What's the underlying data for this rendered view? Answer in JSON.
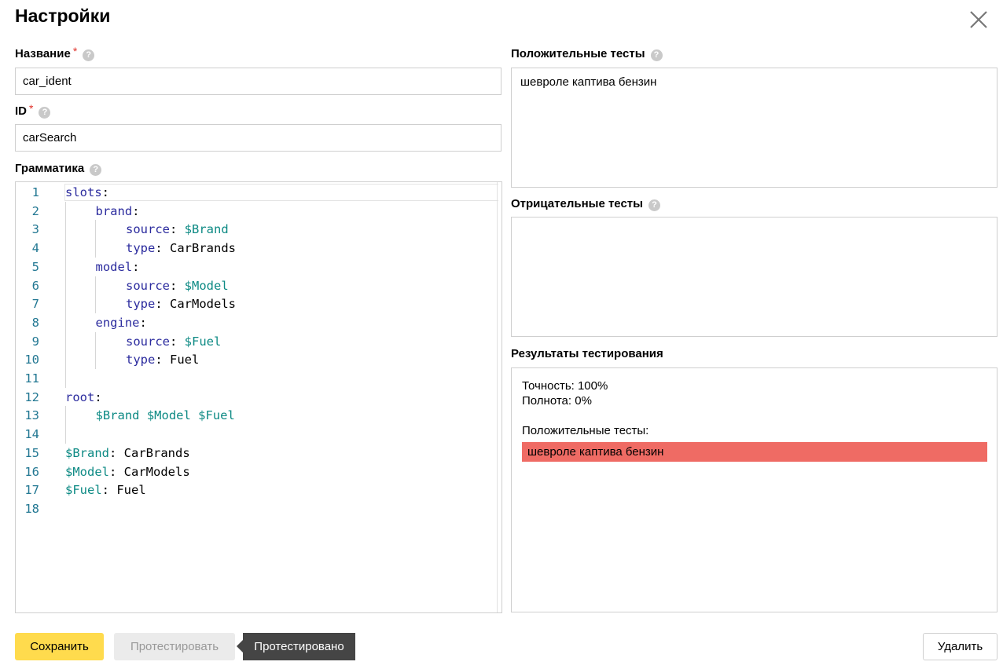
{
  "dialog": {
    "title": "Настройки"
  },
  "fields": {
    "name": {
      "label": "Название",
      "required_mark": "*",
      "value": "car_ident"
    },
    "id": {
      "label": "ID",
      "required_mark": "*",
      "value": "carSearch"
    },
    "grammar": {
      "label": "Грамматика"
    }
  },
  "grammar_lines": [
    {
      "num": "1",
      "key": "slots",
      "sep": ":",
      "val": ""
    },
    {
      "num": "2",
      "key": "brand",
      "sep": ":",
      "val": ""
    },
    {
      "num": "3",
      "key": "source",
      "sep": ": ",
      "val": "$Brand"
    },
    {
      "num": "4",
      "key": "type",
      "sep": ": ",
      "val": "CarBrands"
    },
    {
      "num": "5",
      "key": "model",
      "sep": ":",
      "val": ""
    },
    {
      "num": "6",
      "key": "source",
      "sep": ": ",
      "val": "$Model"
    },
    {
      "num": "7",
      "key": "type",
      "sep": ": ",
      "val": "CarModels"
    },
    {
      "num": "8",
      "key": "engine",
      "sep": ":",
      "val": ""
    },
    {
      "num": "9",
      "key": "source",
      "sep": ": ",
      "val": "$Fuel"
    },
    {
      "num": "10",
      "key": "type",
      "sep": ": ",
      "val": "Fuel"
    },
    {
      "num": "11",
      "key": "",
      "sep": "",
      "val": ""
    },
    {
      "num": "12",
      "key": "root",
      "sep": ":",
      "val": ""
    },
    {
      "num": "13",
      "key": "",
      "sep": "",
      "val": "$Brand $Model $Fuel"
    },
    {
      "num": "14",
      "key": "",
      "sep": "",
      "val": ""
    },
    {
      "num": "15",
      "key": "$Brand",
      "sep": ": ",
      "val": "CarBrands"
    },
    {
      "num": "16",
      "key": "$Model",
      "sep": ": ",
      "val": "CarModels"
    },
    {
      "num": "17",
      "key": "$Fuel",
      "sep": ": ",
      "val": "Fuel"
    },
    {
      "num": "18",
      "key": "",
      "sep": "",
      "val": ""
    }
  ],
  "positive_tests": {
    "label": "Положительные тесты",
    "value": "шевроле каптива бензин"
  },
  "negative_tests": {
    "label": "Отрицательные тесты",
    "value": ""
  },
  "results": {
    "label": "Результаты тестирования",
    "precision": "Точность: 100%",
    "recall": "Полнота: 0%",
    "positive_header": "Положительные тесты:",
    "failed_items": [
      "шевроле каптива бензин"
    ]
  },
  "buttons": {
    "save": "Сохранить",
    "test": "Протестировать",
    "tested_tooltip": "Протестировано",
    "delete": "Удалить"
  },
  "colors": {
    "accent_yellow": "#ffdb4d",
    "fail_red": "#ef6b64",
    "required_red": "#e0322b",
    "code_keyword": "#2b2b9e",
    "code_value": "#0d8a84",
    "line_number": "#237893"
  }
}
